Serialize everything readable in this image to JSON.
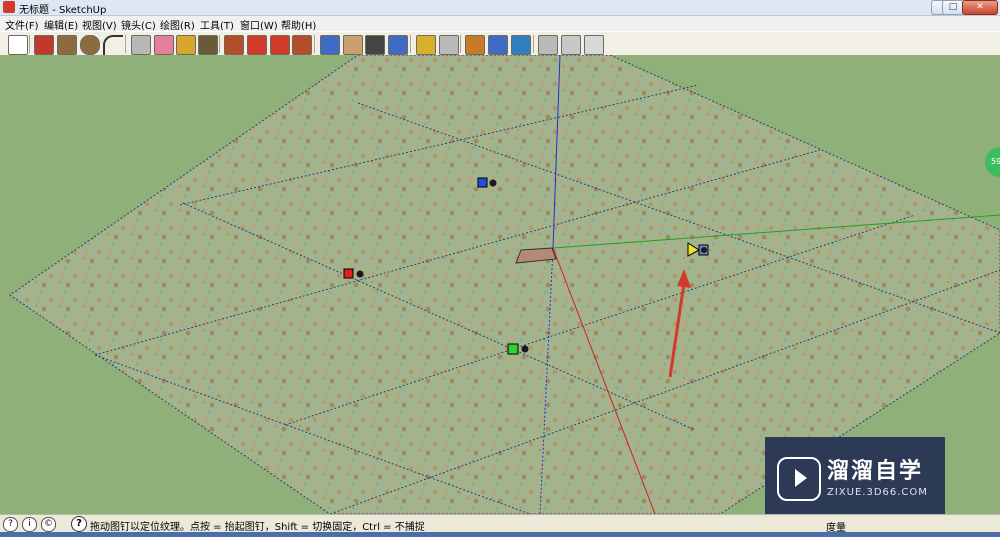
{
  "window": {
    "title": "无标题 - SketchUp",
    "controls": {
      "minimize": "–",
      "maximize": "□",
      "close": "✕"
    }
  },
  "menubar": {
    "items": [
      "文件(F)",
      "编辑(E)",
      "视图(V)",
      "镜头(C)",
      "绘图(R)",
      "工具(T)",
      "窗口(W)",
      "帮助(H)"
    ]
  },
  "toolbar": {
    "tools": [
      {
        "icon": "select-arrow-icon",
        "color": "#ffffff"
      },
      {
        "icon": "pencil-line-icon",
        "color": "#c0392b"
      },
      {
        "icon": "rectangle-icon",
        "color": "#8b6b3f"
      },
      {
        "icon": "circle-icon",
        "color": "#8b6b3f"
      },
      {
        "icon": "arc-icon",
        "color": "#333333"
      },
      {
        "icon": "make-component-icon",
        "color": "#b7b7b7"
      },
      {
        "icon": "eraser-icon",
        "color": "#e57e9d"
      },
      {
        "icon": "tape-measure-icon",
        "color": "#d8a62b"
      },
      {
        "icon": "paint-bucket-icon",
        "color": "#6b5a3a"
      },
      {
        "icon": "push-pull-icon",
        "color": "#b34d2a"
      },
      {
        "icon": "move-icon",
        "color": "#d23a2a"
      },
      {
        "icon": "rotate-icon",
        "color": "#d23a2a"
      },
      {
        "icon": "follow-me-icon",
        "color": "#b34d2a"
      },
      {
        "icon": "orbit-icon",
        "color": "#3f6bc4"
      },
      {
        "icon": "pan-hand-icon",
        "color": "#c9a16f"
      },
      {
        "icon": "zoom-icon",
        "color": "#444444"
      },
      {
        "icon": "zoom-extents-icon",
        "color": "#3f6bc4"
      },
      {
        "icon": "add-location-icon",
        "color": "#d8b02b"
      },
      {
        "icon": "toggle-terrain-icon",
        "color": "#b9b9b9"
      },
      {
        "icon": "get-models-icon",
        "color": "#c77a2a"
      },
      {
        "icon": "share-model-icon",
        "color": "#3f6bc4"
      },
      {
        "icon": "preview-google-earth-icon",
        "color": "#2f7fc1"
      },
      {
        "icon": "photo-textures-icon",
        "color": "#b9b9b9"
      },
      {
        "icon": "get-photo-icon",
        "color": "#c8c8c8"
      },
      {
        "icon": "style-icon",
        "color": "#d8d8d8"
      }
    ]
  },
  "viewport": {
    "background": "#8fb179",
    "axis_colors": {
      "x": "#d02020",
      "y": "#20a020",
      "z": "#2030d0"
    },
    "texture_pins": [
      {
        "name": "blue-pin",
        "color": "#2050e0",
        "role": "Scale/Shear"
      },
      {
        "name": "red-pin",
        "color": "#e02020",
        "role": "Move"
      },
      {
        "name": "green-pin",
        "color": "#30d030",
        "role": "Scale/Rotate"
      },
      {
        "name": "yellow-pin",
        "color": "#f2e12e",
        "role": "Distort"
      }
    ],
    "scroll_badge": "59"
  },
  "watermark": {
    "title": "溜溜自学",
    "subtitle": "ZIXUE.3D66.COM"
  },
  "statusbar": {
    "text": "拖动图钉以定位纹理。点按 = 抬起图钉，Shift = 切换固定，Ctrl = 不捕捉",
    "help_glyph": "?",
    "measure_label": "度量"
  }
}
